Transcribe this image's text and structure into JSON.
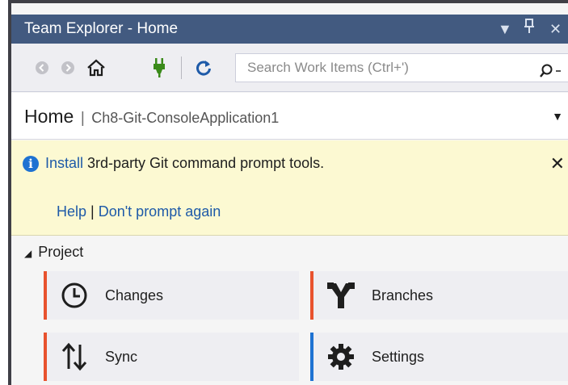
{
  "window": {
    "title": "Team Explorer - Home",
    "controls": [
      "▼",
      "ᛘ",
      "✕"
    ]
  },
  "toolbar": {
    "search_placeholder": "Search Work Items (Ctrl+')"
  },
  "header": {
    "page": "Home",
    "separator": "|",
    "repository": "Ch8-Git-ConsoleApplication1"
  },
  "banner": {
    "install_link": "Install",
    "message": " 3rd-party Git command prompt tools.",
    "help_link": "Help",
    "separator": " | ",
    "dont_prompt_link": "Don't prompt again",
    "close": "✕"
  },
  "project": {
    "title": "Project",
    "tiles": [
      {
        "label": "Changes",
        "icon": "clock-icon",
        "accent": "#e8522e"
      },
      {
        "label": "Branches",
        "icon": "branch-icon",
        "accent": "#e8522e"
      },
      {
        "label": "Sync",
        "icon": "sync-arrows-icon",
        "accent": "#e8522e"
      },
      {
        "label": "Settings",
        "icon": "gear-icon",
        "accent": "#1e72d2"
      }
    ]
  },
  "colors": {
    "titlebar": "#425a80",
    "banner": "#fcf9d2",
    "link": "#1e5aa8",
    "accent_orange": "#e8522e",
    "accent_blue": "#1e72d2"
  }
}
